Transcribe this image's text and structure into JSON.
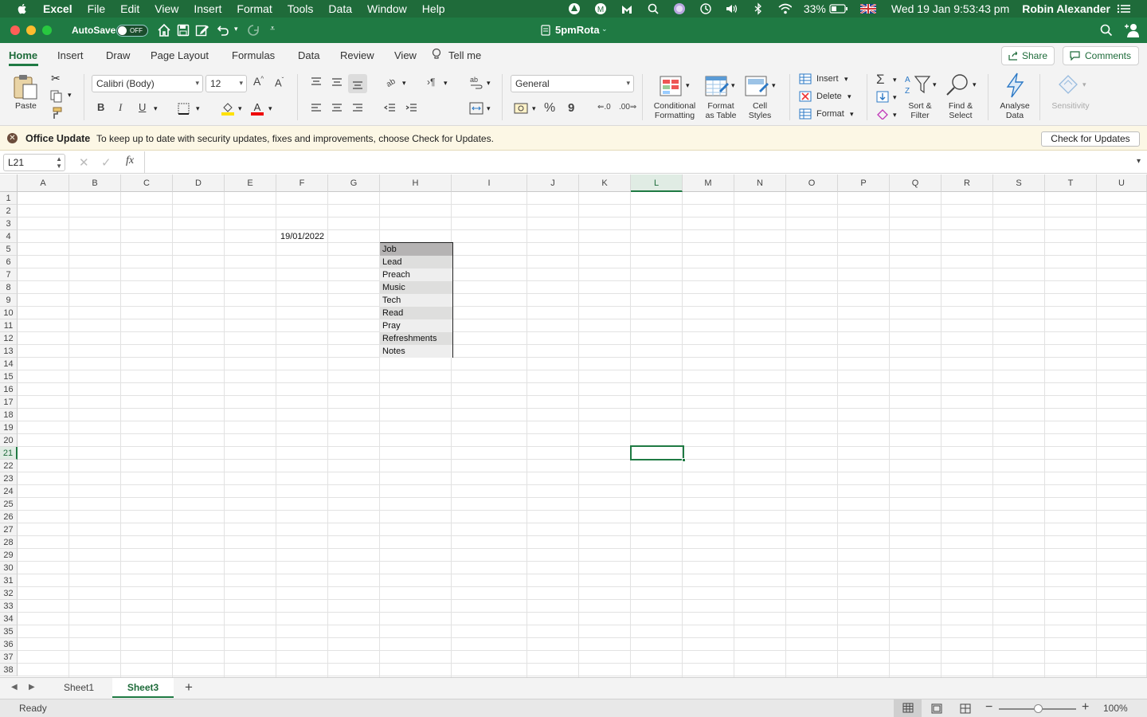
{
  "menubar": {
    "app_name": "Excel",
    "items": [
      "File",
      "Edit",
      "View",
      "Insert",
      "Format",
      "Tools",
      "Data",
      "Window",
      "Help"
    ],
    "battery": "33%",
    "datetime": "Wed 19 Jan  9:53:43 pm",
    "user": "Robin Alexander"
  },
  "titlebar": {
    "autosave_label": "AutoSave",
    "autosave_state": "OFF",
    "doc_title": "5pmRota"
  },
  "ribbon_tabs": {
    "tabs": [
      "Home",
      "Insert",
      "Draw",
      "Page Layout",
      "Formulas",
      "Data",
      "Review",
      "View"
    ],
    "tell_me": "Tell me",
    "share": "Share",
    "comments": "Comments"
  },
  "ribbon": {
    "paste": "Paste",
    "font_name": "Calibri (Body)",
    "font_size": "12",
    "bold": "B",
    "italic": "I",
    "underline": "U",
    "number_format": "General",
    "percent": "%",
    "comma": "9",
    "conditional_formatting": [
      "Conditional",
      "Formatting"
    ],
    "format_as_table": [
      "Format",
      "as Table"
    ],
    "cell_styles": [
      "Cell",
      "Styles"
    ],
    "insert": "Insert",
    "delete": "Delete",
    "format": "Format",
    "sort_filter": [
      "Sort &",
      "Filter"
    ],
    "find_select": [
      "Find &",
      "Select"
    ],
    "analyse_data": [
      "Analyse",
      "Data"
    ],
    "sensitivity": "Sensitivity"
  },
  "update_bar": {
    "title": "Office Update",
    "message": "To keep up to date with security updates, fixes and improvements, choose Check for Updates.",
    "button": "Check for Updates"
  },
  "formula_bar": {
    "name_box": "L21",
    "fx": "fx",
    "value": ""
  },
  "grid": {
    "columns": [
      "A",
      "B",
      "C",
      "D",
      "E",
      "F",
      "G",
      "H",
      "I",
      "J",
      "K",
      "L",
      "M",
      "N",
      "O",
      "P",
      "Q",
      "R",
      "S",
      "T",
      "U"
    ],
    "rows": [
      "1",
      "2",
      "3",
      "4",
      "5",
      "6",
      "7",
      "8",
      "9",
      "10",
      "11",
      "12",
      "13",
      "14",
      "15",
      "16",
      "17",
      "18",
      "19",
      "20",
      "21",
      "22",
      "23",
      "24",
      "25",
      "26",
      "27",
      "28",
      "29",
      "30",
      "31",
      "32",
      "33",
      "34",
      "35",
      "36",
      "37",
      "38"
    ],
    "selected_column": "L",
    "selected_row": "21",
    "date_cell": {
      "ref": "F4",
      "value": "19/01/2022"
    },
    "table_cells": [
      "Job",
      "Lead",
      "Preach",
      "Music",
      "Tech",
      "Read",
      "Pray",
      "Refreshments",
      "Notes"
    ]
  },
  "sheets": {
    "tabs": [
      "Sheet1",
      "Sheet3"
    ],
    "active": "Sheet3",
    "add": "+"
  },
  "status": {
    "mode": "Ready",
    "zoom": "100%"
  }
}
